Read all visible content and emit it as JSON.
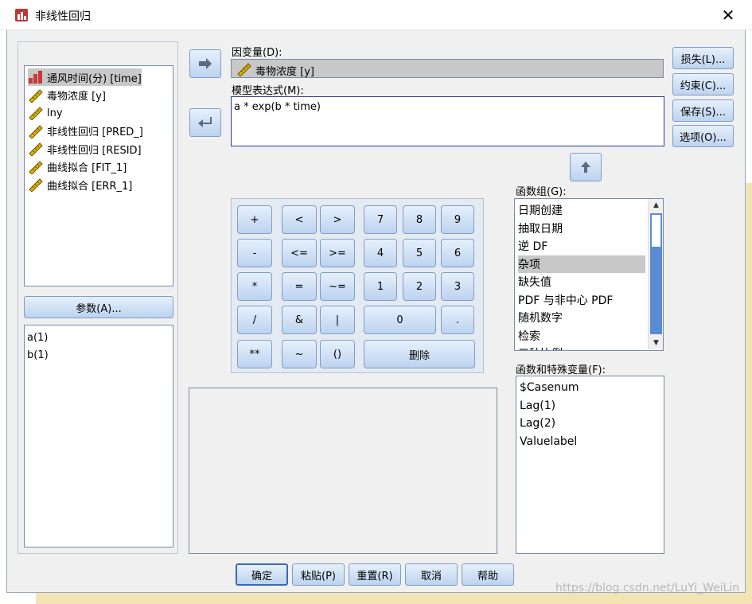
{
  "window": {
    "title": "非线性回归"
  },
  "variables": [
    {
      "label": "通风时间(分) [time]",
      "icon": "scale-bar-icon",
      "selected": true
    },
    {
      "label": "毒物浓度 [y]",
      "icon": "ruler-icon"
    },
    {
      "label": "lny",
      "icon": "ruler-icon"
    },
    {
      "label": "非线性回归 [PRED_]",
      "icon": "ruler-icon"
    },
    {
      "label": "非线性回归 [RESID]",
      "icon": "ruler-icon"
    },
    {
      "label": "曲线拟合 [FIT_1]",
      "icon": "ruler-icon"
    },
    {
      "label": "曲线拟合 [ERR_1]",
      "icon": "ruler-icon"
    }
  ],
  "params_button": "参数(A)...",
  "parameters": [
    "a(1)",
    "b(1)"
  ],
  "dependent": {
    "label": "因变量(D):",
    "value": "毒物浓度 [y]"
  },
  "expression": {
    "label": "模型表达式(M):",
    "value": "a * exp(b  * time)"
  },
  "side_buttons": [
    "损失(L)...",
    "约束(C)...",
    "保存(S)...",
    "选项(O)..."
  ],
  "calc_keys": {
    "ops": [
      "+",
      "<",
      ">",
      "-",
      "<=",
      ">=",
      "*",
      "=",
      "~=",
      "/",
      "&",
      "|",
      "**",
      "~",
      "()"
    ],
    "digits": [
      "7",
      "8",
      "9",
      "4",
      "5",
      "6",
      "1",
      "2",
      "3"
    ],
    "zero": "0",
    "dot": ".",
    "delete": "删除"
  },
  "func_group": {
    "label": "函数组(G):",
    "items": [
      "日期创建",
      "抽取日期",
      "逆 DF",
      "杂项",
      "缺失值",
      "PDF 与非中心 PDF",
      "随机数字",
      "检索",
      "三种比例"
    ],
    "selected_index": 3
  },
  "special_vars": {
    "label": "函数和特殊变量(F):",
    "items": [
      "$Casenum",
      "Lag(1)",
      "Lag(2)",
      "Valuelabel"
    ]
  },
  "footer_buttons": [
    "确定",
    "粘贴(P)",
    "重置(R)",
    "取消",
    "帮助"
  ],
  "watermark": "https://blog.csdn.net/LuYi_WeiLin"
}
